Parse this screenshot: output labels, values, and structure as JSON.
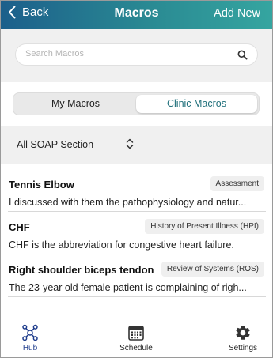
{
  "header": {
    "back_label": "Back",
    "title": "Macros",
    "add_label": "Add New"
  },
  "search": {
    "placeholder": "Search Macros"
  },
  "segments": {
    "my": "My Macros",
    "clinic": "Clinic Macros",
    "selected": "Clinic Macros"
  },
  "filter": {
    "label": "All SOAP Section"
  },
  "macros": [
    {
      "name": "Tennis Elbow",
      "section": "Assessment",
      "text": "I discussed with them the pathophysiology and natur..."
    },
    {
      "name": "CHF",
      "section": "History of Present Illness (HPI)",
      "text": "CHF is the abbreviation for congestive heart failure."
    },
    {
      "name": "Right shoulder biceps tendon",
      "section": "Review of Systems (ROS)",
      "text": "The 23-year old female patient is complaining of righ..."
    }
  ],
  "tabs": {
    "hub": "Hub",
    "schedule": "Schedule",
    "settings": "Settings",
    "active": "Hub"
  },
  "colors": {
    "header_start": "#1c5f8b",
    "header_end": "#35a5a0",
    "accent_teal": "#1f6f7a",
    "hub_active": "#1e3c8c"
  }
}
